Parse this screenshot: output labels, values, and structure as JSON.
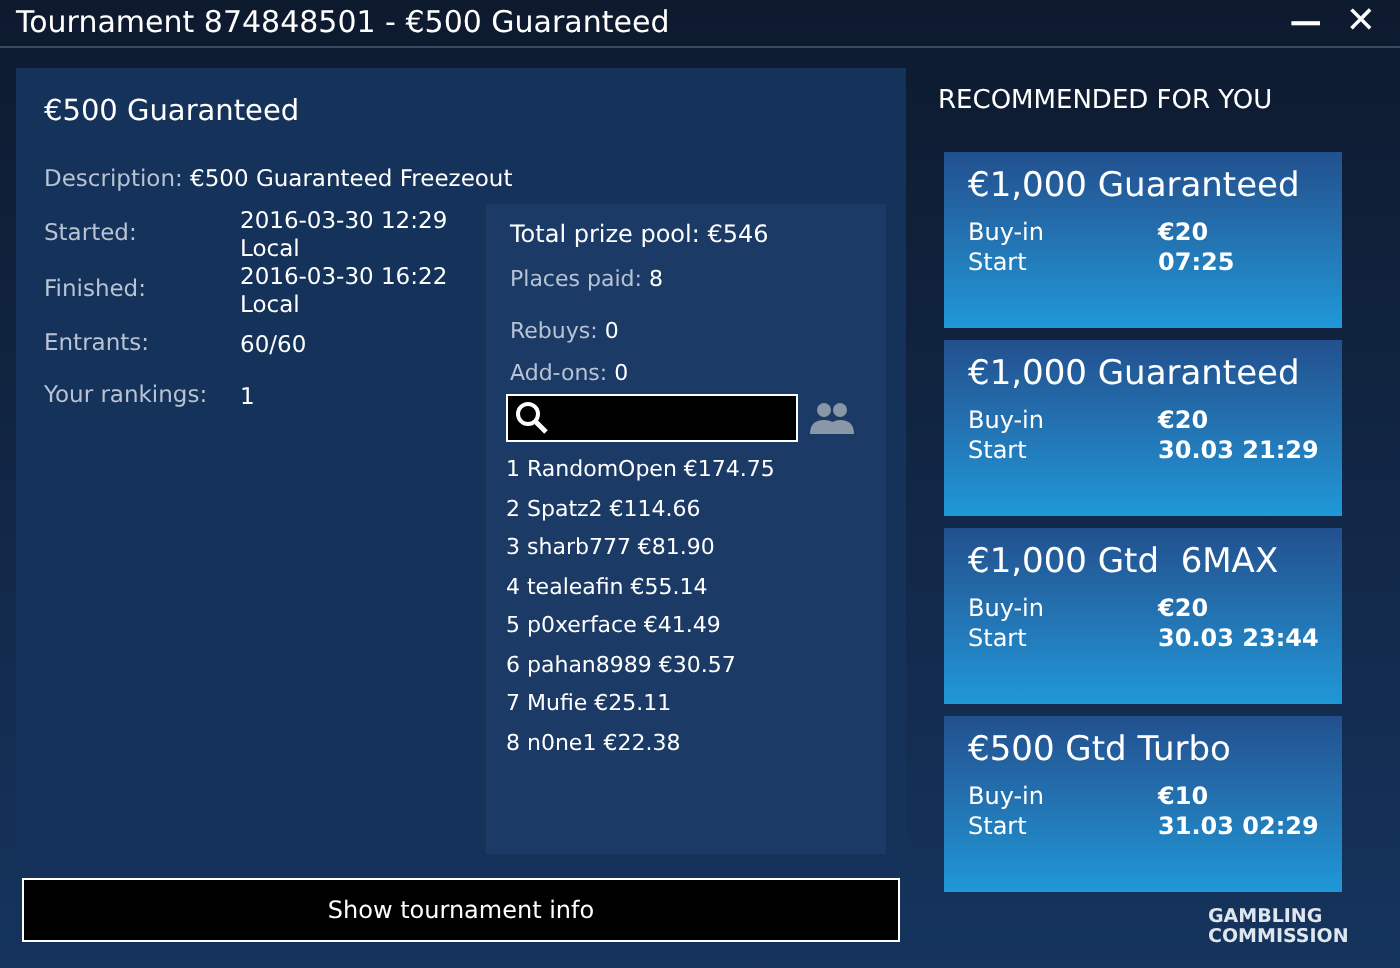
{
  "window": {
    "title": "Tournament 874848501 - €500 Guaranteed",
    "controls": [
      "—",
      "✕"
    ]
  },
  "details": {
    "title": "€500 Guaranteed",
    "description": {
      "label": "Description:",
      "value": "€500 Guaranteed Freezeout"
    },
    "fields": [
      {
        "label": "Started:",
        "value": [
          "2016-03-30 12:29",
          "Local"
        ]
      },
      {
        "label": "Finished:",
        "value": [
          "2016-03-30 16:22",
          "Local"
        ]
      },
      {
        "label": "Entrants:",
        "value": [
          "60/60"
        ]
      },
      {
        "label": "Your rankings:",
        "value": [
          "1"
        ]
      }
    ]
  },
  "prizes": {
    "total": "Total prize pool: €546",
    "places_paid": {
      "label": "Places paid:",
      "value": "8"
    },
    "rebuys": {
      "label": "Rebuys:",
      "value": "0"
    },
    "addons": {
      "label": "Add-ons:",
      "value": "0"
    },
    "results": [
      "1 RandomOpen €174.75",
      "2 Spatz2 €114.66",
      "3 sharb777 €81.90",
      "4 tealeafin €55.14",
      "5 p0xerface €41.49",
      "6 pahan8989 €30.57",
      "7 Mufie €25.11",
      "8 n0ne1 €22.38"
    ]
  },
  "info_button": "Show tournament info",
  "recommended": {
    "heading": "RECOMMENDED FOR YOU",
    "cards": [
      {
        "title": "€1,000 Guaranteed",
        "buyin_label": "Buy-in",
        "buyin": "€20",
        "start_label": "Start",
        "start": "07:25"
      },
      {
        "title": "€1,000 Guaranteed",
        "buyin_label": "Buy-in",
        "buyin": "€20",
        "start_label": "Start",
        "start": "30.03 21:29"
      },
      {
        "title": "€1,000 Gtd  6MAX",
        "buyin_label": "Buy-in",
        "buyin": "€20",
        "start_label": "Start",
        "start": "30.03 23:44"
      },
      {
        "title": "€500 Gtd Turbo",
        "buyin_label": "Buy-in",
        "buyin": "€10",
        "start_label": "Start",
        "start": "31.03 02:29"
      }
    ]
  },
  "footer_logo": [
    "GAMBLING",
    "COMMISSION"
  ]
}
